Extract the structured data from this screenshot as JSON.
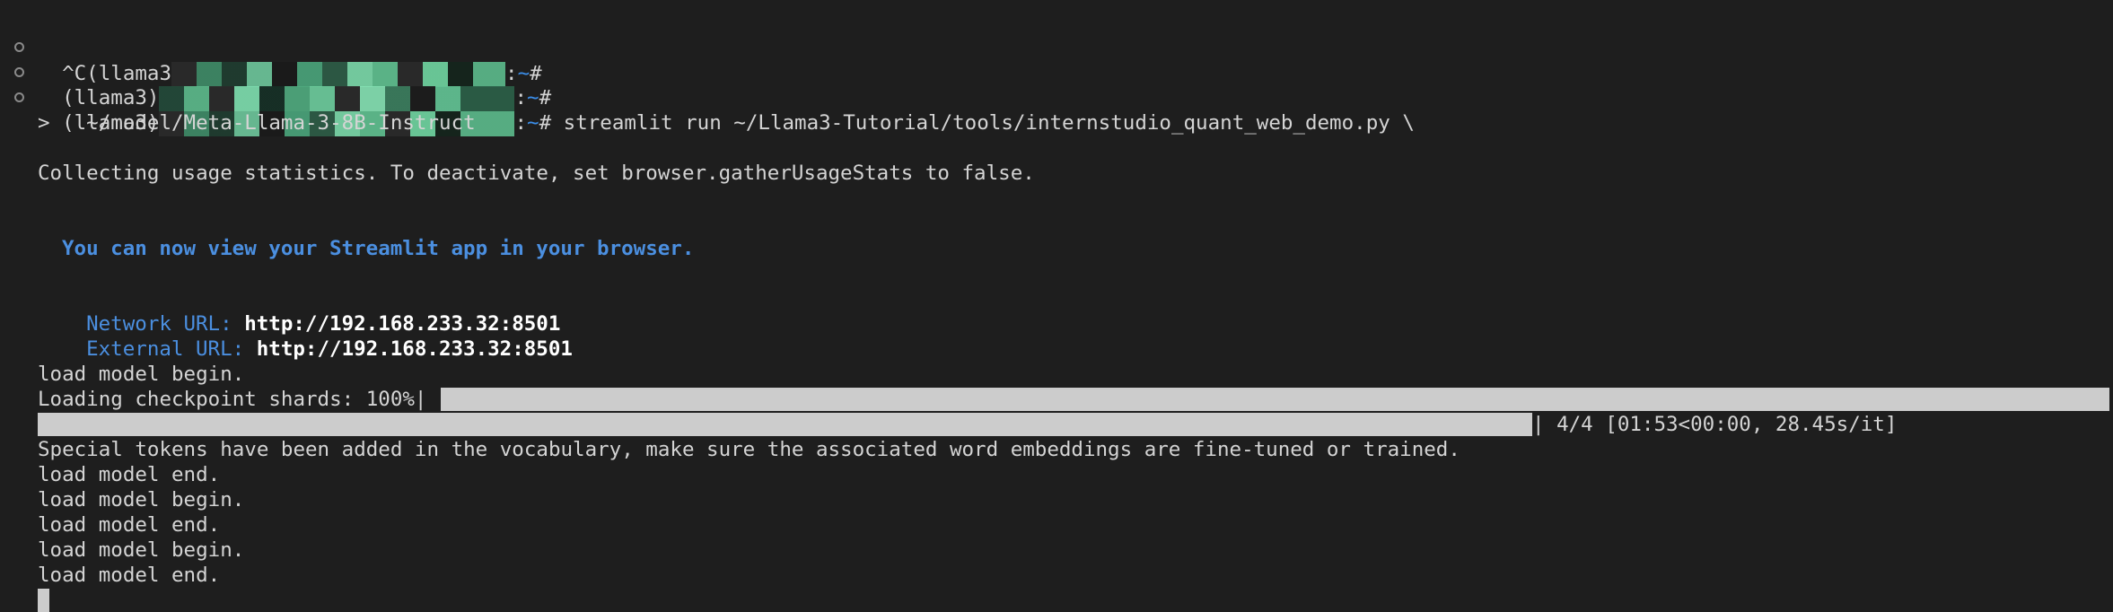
{
  "prompt": {
    "line1_prefix": "^C(llama3",
    "line1_suffix": ":",
    "line2_prefix": "(llama3)",
    "line2_suffix": ":",
    "line3_prefix": "(llama3)",
    "line3_suffix": ":",
    "tilde": "~",
    "hash": "#",
    "hash_cmd": "# streamlit run ~/Llama3-Tutorial/tools/internstudio_quant_web_demo.py \\",
    "continuation": ">   ~/model/Meta-Llama-3-8B-Instruct"
  },
  "output": {
    "usage_stats": "Collecting usage statistics. To deactivate, set browser.gatherUsageStats to false.",
    "view_app": "You can now view your Streamlit app in your browser.",
    "network_label": "Network URL: ",
    "network_url": "http://192.168.233.32:8501",
    "external_label": "External URL: ",
    "external_url": "http://192.168.233.32:8501",
    "load_begin_1": "load model begin.",
    "loading_shards": "Loading checkpoint shards: 100%|",
    "progress_suffix": "| 4/4 [01:53<00:00, 28.45s/it]",
    "progress_fraction": 1.0,
    "special_tokens": "Special tokens have been added in the vocabulary, make sure the associated word embeddings are fine-tuned or trained.",
    "load_end_1": "load model end.",
    "load_begin_2": "load model begin.",
    "load_end_2": "load model end.",
    "load_begin_3": "load model begin.",
    "load_end_3": "load model end."
  }
}
